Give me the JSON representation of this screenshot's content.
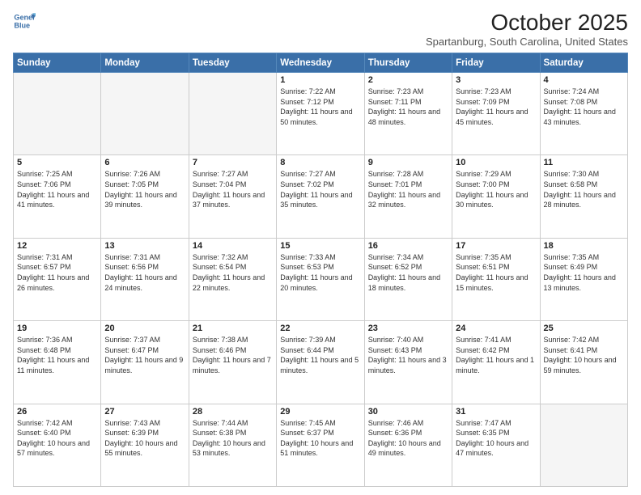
{
  "logo": {
    "line1": "General",
    "line2": "Blue"
  },
  "title": "October 2025",
  "location": "Spartanburg, South Carolina, United States",
  "weekdays": [
    "Sunday",
    "Monday",
    "Tuesday",
    "Wednesday",
    "Thursday",
    "Friday",
    "Saturday"
  ],
  "weeks": [
    [
      {
        "day": "",
        "info": ""
      },
      {
        "day": "",
        "info": ""
      },
      {
        "day": "",
        "info": ""
      },
      {
        "day": "1",
        "info": "Sunrise: 7:22 AM\nSunset: 7:12 PM\nDaylight: 11 hours\nand 50 minutes."
      },
      {
        "day": "2",
        "info": "Sunrise: 7:23 AM\nSunset: 7:11 PM\nDaylight: 11 hours\nand 48 minutes."
      },
      {
        "day": "3",
        "info": "Sunrise: 7:23 AM\nSunset: 7:09 PM\nDaylight: 11 hours\nand 45 minutes."
      },
      {
        "day": "4",
        "info": "Sunrise: 7:24 AM\nSunset: 7:08 PM\nDaylight: 11 hours\nand 43 minutes."
      }
    ],
    [
      {
        "day": "5",
        "info": "Sunrise: 7:25 AM\nSunset: 7:06 PM\nDaylight: 11 hours\nand 41 minutes."
      },
      {
        "day": "6",
        "info": "Sunrise: 7:26 AM\nSunset: 7:05 PM\nDaylight: 11 hours\nand 39 minutes."
      },
      {
        "day": "7",
        "info": "Sunrise: 7:27 AM\nSunset: 7:04 PM\nDaylight: 11 hours\nand 37 minutes."
      },
      {
        "day": "8",
        "info": "Sunrise: 7:27 AM\nSunset: 7:02 PM\nDaylight: 11 hours\nand 35 minutes."
      },
      {
        "day": "9",
        "info": "Sunrise: 7:28 AM\nSunset: 7:01 PM\nDaylight: 11 hours\nand 32 minutes."
      },
      {
        "day": "10",
        "info": "Sunrise: 7:29 AM\nSunset: 7:00 PM\nDaylight: 11 hours\nand 30 minutes."
      },
      {
        "day": "11",
        "info": "Sunrise: 7:30 AM\nSunset: 6:58 PM\nDaylight: 11 hours\nand 28 minutes."
      }
    ],
    [
      {
        "day": "12",
        "info": "Sunrise: 7:31 AM\nSunset: 6:57 PM\nDaylight: 11 hours\nand 26 minutes."
      },
      {
        "day": "13",
        "info": "Sunrise: 7:31 AM\nSunset: 6:56 PM\nDaylight: 11 hours\nand 24 minutes."
      },
      {
        "day": "14",
        "info": "Sunrise: 7:32 AM\nSunset: 6:54 PM\nDaylight: 11 hours\nand 22 minutes."
      },
      {
        "day": "15",
        "info": "Sunrise: 7:33 AM\nSunset: 6:53 PM\nDaylight: 11 hours\nand 20 minutes."
      },
      {
        "day": "16",
        "info": "Sunrise: 7:34 AM\nSunset: 6:52 PM\nDaylight: 11 hours\nand 18 minutes."
      },
      {
        "day": "17",
        "info": "Sunrise: 7:35 AM\nSunset: 6:51 PM\nDaylight: 11 hours\nand 15 minutes."
      },
      {
        "day": "18",
        "info": "Sunrise: 7:35 AM\nSunset: 6:49 PM\nDaylight: 11 hours\nand 13 minutes."
      }
    ],
    [
      {
        "day": "19",
        "info": "Sunrise: 7:36 AM\nSunset: 6:48 PM\nDaylight: 11 hours\nand 11 minutes."
      },
      {
        "day": "20",
        "info": "Sunrise: 7:37 AM\nSunset: 6:47 PM\nDaylight: 11 hours\nand 9 minutes."
      },
      {
        "day": "21",
        "info": "Sunrise: 7:38 AM\nSunset: 6:46 PM\nDaylight: 11 hours\nand 7 minutes."
      },
      {
        "day": "22",
        "info": "Sunrise: 7:39 AM\nSunset: 6:44 PM\nDaylight: 11 hours\nand 5 minutes."
      },
      {
        "day": "23",
        "info": "Sunrise: 7:40 AM\nSunset: 6:43 PM\nDaylight: 11 hours\nand 3 minutes."
      },
      {
        "day": "24",
        "info": "Sunrise: 7:41 AM\nSunset: 6:42 PM\nDaylight: 11 hours\nand 1 minute."
      },
      {
        "day": "25",
        "info": "Sunrise: 7:42 AM\nSunset: 6:41 PM\nDaylight: 10 hours\nand 59 minutes."
      }
    ],
    [
      {
        "day": "26",
        "info": "Sunrise: 7:42 AM\nSunset: 6:40 PM\nDaylight: 10 hours\nand 57 minutes."
      },
      {
        "day": "27",
        "info": "Sunrise: 7:43 AM\nSunset: 6:39 PM\nDaylight: 10 hours\nand 55 minutes."
      },
      {
        "day": "28",
        "info": "Sunrise: 7:44 AM\nSunset: 6:38 PM\nDaylight: 10 hours\nand 53 minutes."
      },
      {
        "day": "29",
        "info": "Sunrise: 7:45 AM\nSunset: 6:37 PM\nDaylight: 10 hours\nand 51 minutes."
      },
      {
        "day": "30",
        "info": "Sunrise: 7:46 AM\nSunset: 6:36 PM\nDaylight: 10 hours\nand 49 minutes."
      },
      {
        "day": "31",
        "info": "Sunrise: 7:47 AM\nSunset: 6:35 PM\nDaylight: 10 hours\nand 47 minutes."
      },
      {
        "day": "",
        "info": ""
      }
    ]
  ]
}
